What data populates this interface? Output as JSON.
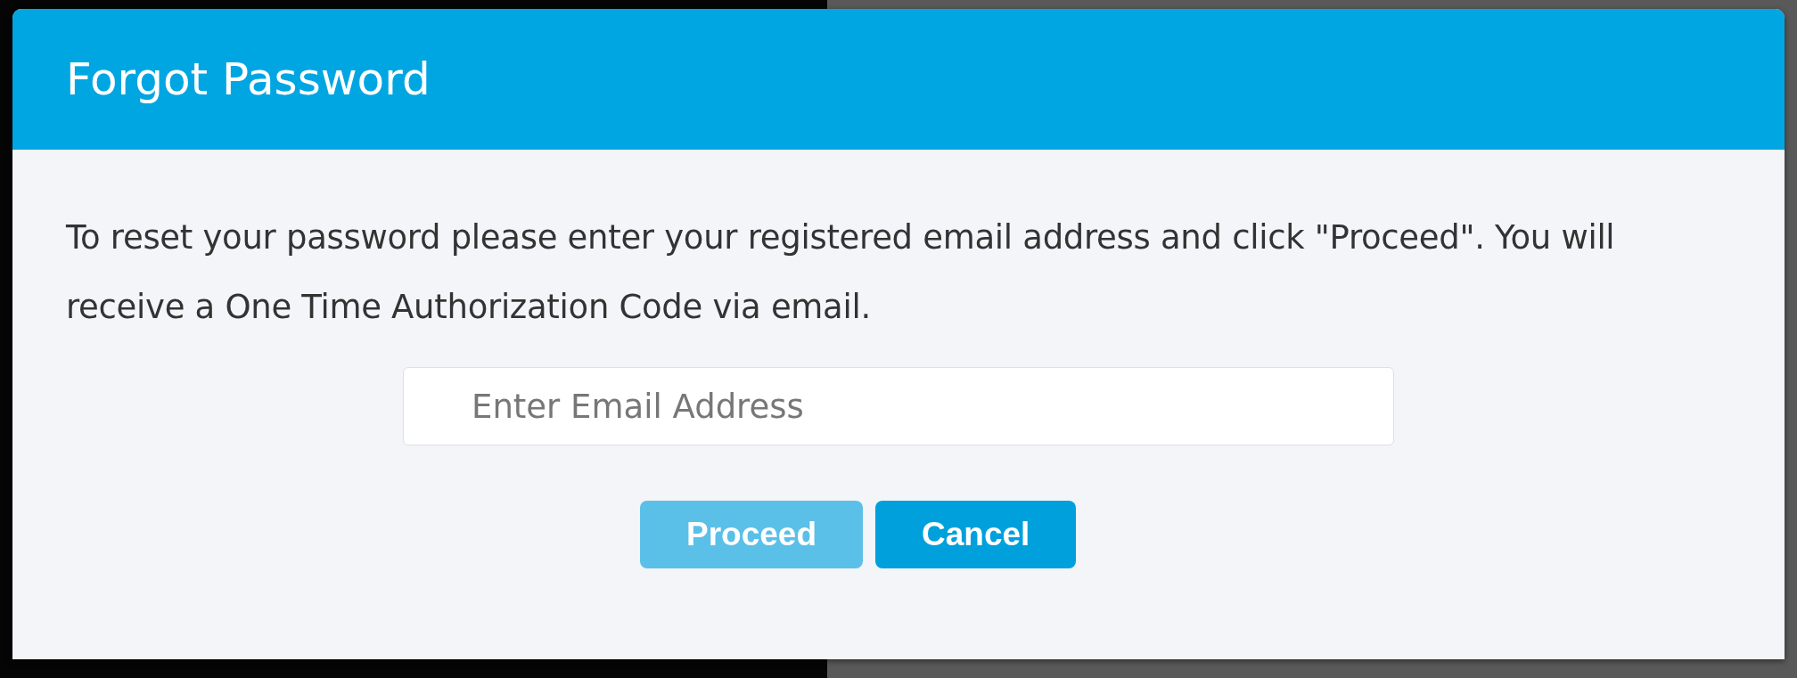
{
  "dialog": {
    "title": "Forgot Password",
    "message": "To reset your password please enter your registered email address and click \"Proceed\". You will receive a One Time Authorization Code via email.",
    "email_field": {
      "placeholder": "Enter Email Address"
    },
    "buttons": [
      {
        "label": "Proceed",
        "disabled": true
      },
      {
        "label": "Cancel",
        "disabled": false
      }
    ]
  }
}
